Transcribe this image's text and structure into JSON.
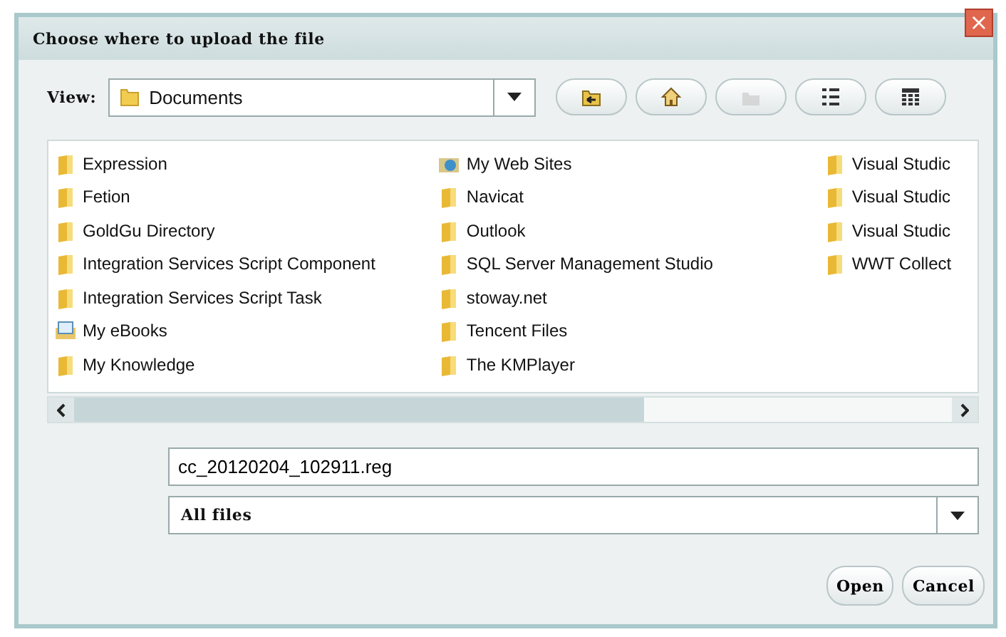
{
  "window": {
    "title": "Choose where to upload the file",
    "close": "×"
  },
  "view": {
    "label": "View:",
    "value": "Documents"
  },
  "files": {
    "columns": [
      [
        {
          "name": "Expression",
          "kind": "folder"
        },
        {
          "name": "Fetion",
          "kind": "folder"
        },
        {
          "name": "GoldGu Directory",
          "kind": "folder"
        },
        {
          "name": "Integration Services Script Component",
          "kind": "folder"
        },
        {
          "name": "Integration Services Script Task",
          "kind": "folder"
        },
        {
          "name": "My eBooks",
          "kind": "ebook"
        },
        {
          "name": "My Knowledge",
          "kind": "folder"
        }
      ],
      [
        {
          "name": "My Web Sites",
          "kind": "web"
        },
        {
          "name": "Navicat",
          "kind": "folder"
        },
        {
          "name": "Outlook",
          "kind": "folder"
        },
        {
          "name": "SQL Server Management Studio",
          "kind": "folder"
        },
        {
          "name": "stoway.net",
          "kind": "folder"
        },
        {
          "name": "Tencent Files",
          "kind": "folder"
        },
        {
          "name": "The KMPlayer",
          "kind": "folder"
        }
      ],
      [
        {
          "name": "Visual Studic",
          "kind": "folder"
        },
        {
          "name": "Visual Studic",
          "kind": "folder"
        },
        {
          "name": "Visual Studic",
          "kind": "folder"
        },
        {
          "name": "WWT Collect",
          "kind": "folder"
        }
      ]
    ]
  },
  "file_name": {
    "value": "cc_20120204_102911.reg"
  },
  "file_type": {
    "value": "All files"
  },
  "buttons": [
    "Open",
    "Cancel"
  ]
}
